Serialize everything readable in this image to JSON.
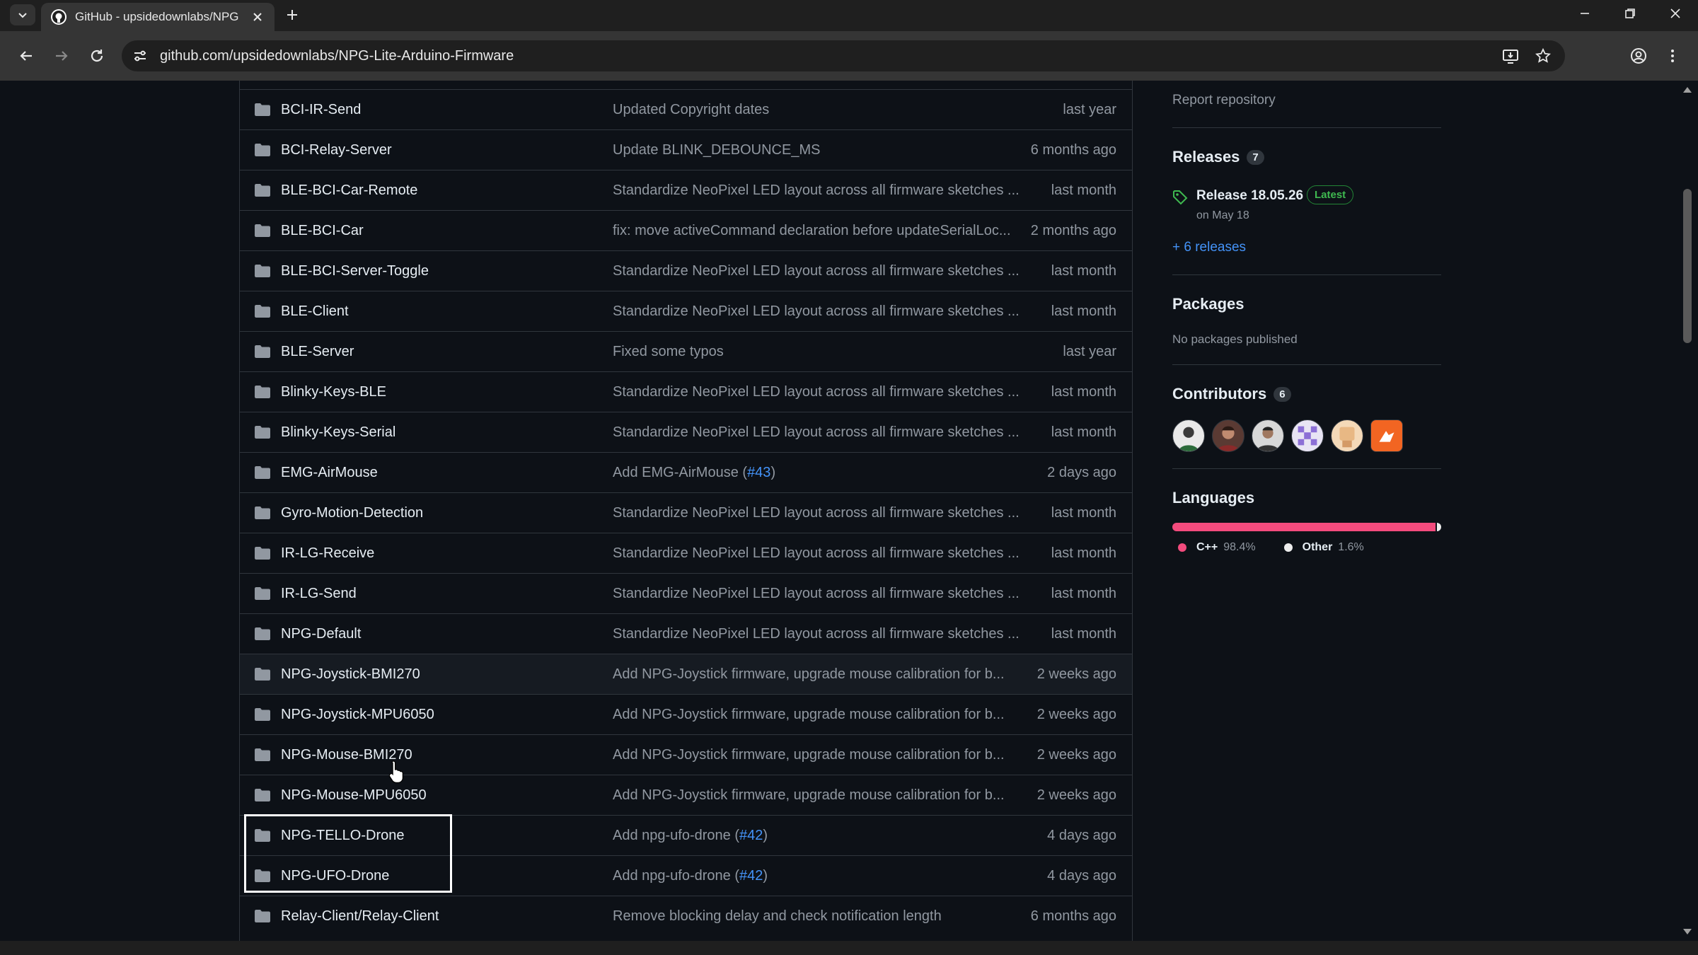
{
  "browser": {
    "tab_title": "GitHub - upsidedownlabs/NPG",
    "url": "github.com/upsidedownlabs/NPG-Lite-Arduino-Firmware"
  },
  "files": [
    {
      "name": "BCI-IR-Send",
      "message": "Updated Copyright dates",
      "issue": "",
      "message_end": "",
      "date": "last year"
    },
    {
      "name": "BCI-Relay-Server",
      "message": "Update BLINK_DEBOUNCE_MS",
      "issue": "",
      "message_end": "",
      "date": "6 months ago"
    },
    {
      "name": "BLE-BCI-Car-Remote",
      "message": "Standardize NeoPixel LED layout across all firmware sketches ...",
      "issue": "",
      "message_end": "",
      "date": "last month"
    },
    {
      "name": "BLE-BCI-Car",
      "message": "fix: move activeCommand declaration before updateSerialLoc...",
      "issue": "",
      "message_end": "",
      "date": "2 months ago"
    },
    {
      "name": "BLE-BCI-Server-Toggle",
      "message": "Standardize NeoPixel LED layout across all firmware sketches ...",
      "issue": "",
      "message_end": "",
      "date": "last month"
    },
    {
      "name": "BLE-Client",
      "message": "Standardize NeoPixel LED layout across all firmware sketches ...",
      "issue": "",
      "message_end": "",
      "date": "last month"
    },
    {
      "name": "BLE-Server",
      "message": "Fixed some typos",
      "issue": "",
      "message_end": "",
      "date": "last year"
    },
    {
      "name": "Blinky-Keys-BLE",
      "message": "Standardize NeoPixel LED layout across all firmware sketches ...",
      "issue": "",
      "message_end": "",
      "date": "last month"
    },
    {
      "name": "Blinky-Keys-Serial",
      "message": "Standardize NeoPixel LED layout across all firmware sketches ...",
      "issue": "",
      "message_end": "",
      "date": "last month"
    },
    {
      "name": "EMG-AirMouse",
      "message": "Add EMG-AirMouse (",
      "issue": "#43",
      "message_end": ")",
      "date": "2 days ago"
    },
    {
      "name": "Gyro-Motion-Detection",
      "message": "Standardize NeoPixel LED layout across all firmware sketches ...",
      "issue": "",
      "message_end": "",
      "date": "last month"
    },
    {
      "name": "IR-LG-Receive",
      "message": "Standardize NeoPixel LED layout across all firmware sketches ...",
      "issue": "",
      "message_end": "",
      "date": "last month"
    },
    {
      "name": "IR-LG-Send",
      "message": "Standardize NeoPixel LED layout across all firmware sketches ...",
      "issue": "",
      "message_end": "",
      "date": "last month"
    },
    {
      "name": "NPG-Default",
      "message": "Standardize NeoPixel LED layout across all firmware sketches ...",
      "issue": "",
      "message_end": "",
      "date": "last month"
    },
    {
      "name": "NPG-Joystick-BMI270",
      "message": "Add NPG-Joystick firmware, upgrade mouse calibration for b...",
      "issue": "",
      "message_end": "",
      "date": "2 weeks ago"
    },
    {
      "name": "NPG-Joystick-MPU6050",
      "message": "Add NPG-Joystick firmware, upgrade mouse calibration for b...",
      "issue": "",
      "message_end": "",
      "date": "2 weeks ago"
    },
    {
      "name": "NPG-Mouse-BMI270",
      "message": "Add NPG-Joystick firmware, upgrade mouse calibration for b...",
      "issue": "",
      "message_end": "",
      "date": "2 weeks ago"
    },
    {
      "name": "NPG-Mouse-MPU6050",
      "message": "Add NPG-Joystick firmware, upgrade mouse calibration for b...",
      "issue": "",
      "message_end": "",
      "date": "2 weeks ago"
    },
    {
      "name": "NPG-TELLO-Drone",
      "message": "Add npg-ufo-drone (",
      "issue": "#42",
      "message_end": ")",
      "date": "4 days ago"
    },
    {
      "name": "NPG-UFO-Drone",
      "message": "Add npg-ufo-drone (",
      "issue": "#42",
      "message_end": ")",
      "date": "4 days ago"
    },
    {
      "name": "Relay-Client/Relay-Client",
      "message": "Remove blocking delay and check notification length",
      "issue": "",
      "message_end": "",
      "date": "6 months ago"
    }
  ],
  "sidebar": {
    "report_link": "Report repository",
    "releases": {
      "heading": "Releases",
      "count": "7",
      "latest_name": "Release 18.05.26",
      "latest_badge": "Latest",
      "latest_date": "on May 18",
      "more_link": "+ 6 releases"
    },
    "packages": {
      "heading": "Packages",
      "empty_text": "No packages published"
    },
    "contributors": {
      "heading": "Contributors",
      "count": "6"
    },
    "languages": {
      "heading": "Languages",
      "items": [
        {
          "name": "C++",
          "percent": "98.4%",
          "value": 98.4,
          "color": "#f34b7d"
        },
        {
          "name": "Other",
          "percent": "1.6%",
          "value": 1.6,
          "color": "#ededed"
        }
      ]
    }
  },
  "colors": {
    "accent_link": "#4493f8",
    "latest_green": "#3fb950",
    "page_bg": "#0d1117"
  }
}
